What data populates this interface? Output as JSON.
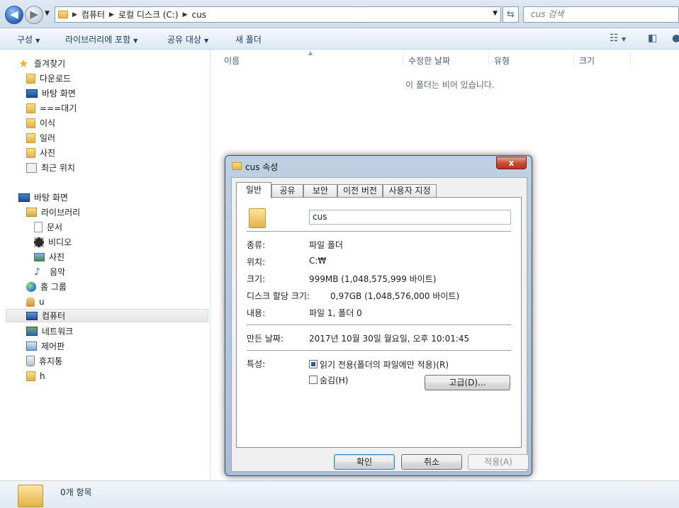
{
  "addressbar": {
    "crumbs": [
      "컴퓨터",
      "로컬 디스크 (C:)",
      "cus"
    ],
    "search_placeholder": "cus 검색"
  },
  "toolbar": {
    "organize": "구성",
    "include_library": "라이브러리에 포함",
    "share_with": "공유 대상",
    "new_folder": "새 폴더"
  },
  "nav": {
    "favorites": "즐겨찾기",
    "downloads": "다운로드",
    "desktop_fav": "바탕 화면",
    "waiting": "===대기",
    "transplant": "이식",
    "illustrator": "일러",
    "photos_fav": "사진",
    "recent": "최근 위치",
    "desktop": "바탕 화면",
    "libraries": "라이브러리",
    "documents": "문서",
    "videos": "비디오",
    "pictures": "사진",
    "music": "음악",
    "homegroup": "홈 그룹",
    "u": "u",
    "computer": "컴퓨터",
    "network": "네트워크",
    "control_panel": "제어판",
    "recycle_bin": "휴지통",
    "h": "h"
  },
  "content": {
    "columns": [
      "이름",
      "수정한 날짜",
      "유형",
      "크기"
    ],
    "empty_message": "이 폴더는 비어 있습니다."
  },
  "status": {
    "item_count": "0개 항목"
  },
  "dialog": {
    "title": "cus 속성",
    "close": "x",
    "tabs": [
      "일반",
      "공유",
      "보안",
      "이전 버전",
      "사용자 지정"
    ],
    "folder_name": "cus",
    "type_label": "종류:",
    "type_value": "파일 폴더",
    "location_label": "위치:",
    "location_value": "C:₩",
    "size_label": "크기:",
    "size_value": "999MB (1,048,575,999 바이트)",
    "disk_size_label": "디스크 할당 크기:",
    "disk_size_value": "0,97GB (1,048,576,000 바이트)",
    "contains_label": "내용:",
    "contains_value": "파일 1, 폴더 0",
    "created_label": "만든 날짜:",
    "created_value": "2017년 10월 30일 월요일, 오후 10:01:45",
    "attributes_label": "특성:",
    "readonly_label": "읽기 전용(폴더의 파일에만 적용)(R)",
    "readonly_checked": true,
    "hidden_label": "숨김(H)",
    "hidden_checked": false,
    "advanced_button": "고급(D)...",
    "ok_button": "확인",
    "cancel_button": "취소",
    "apply_button": "적용(A)"
  }
}
